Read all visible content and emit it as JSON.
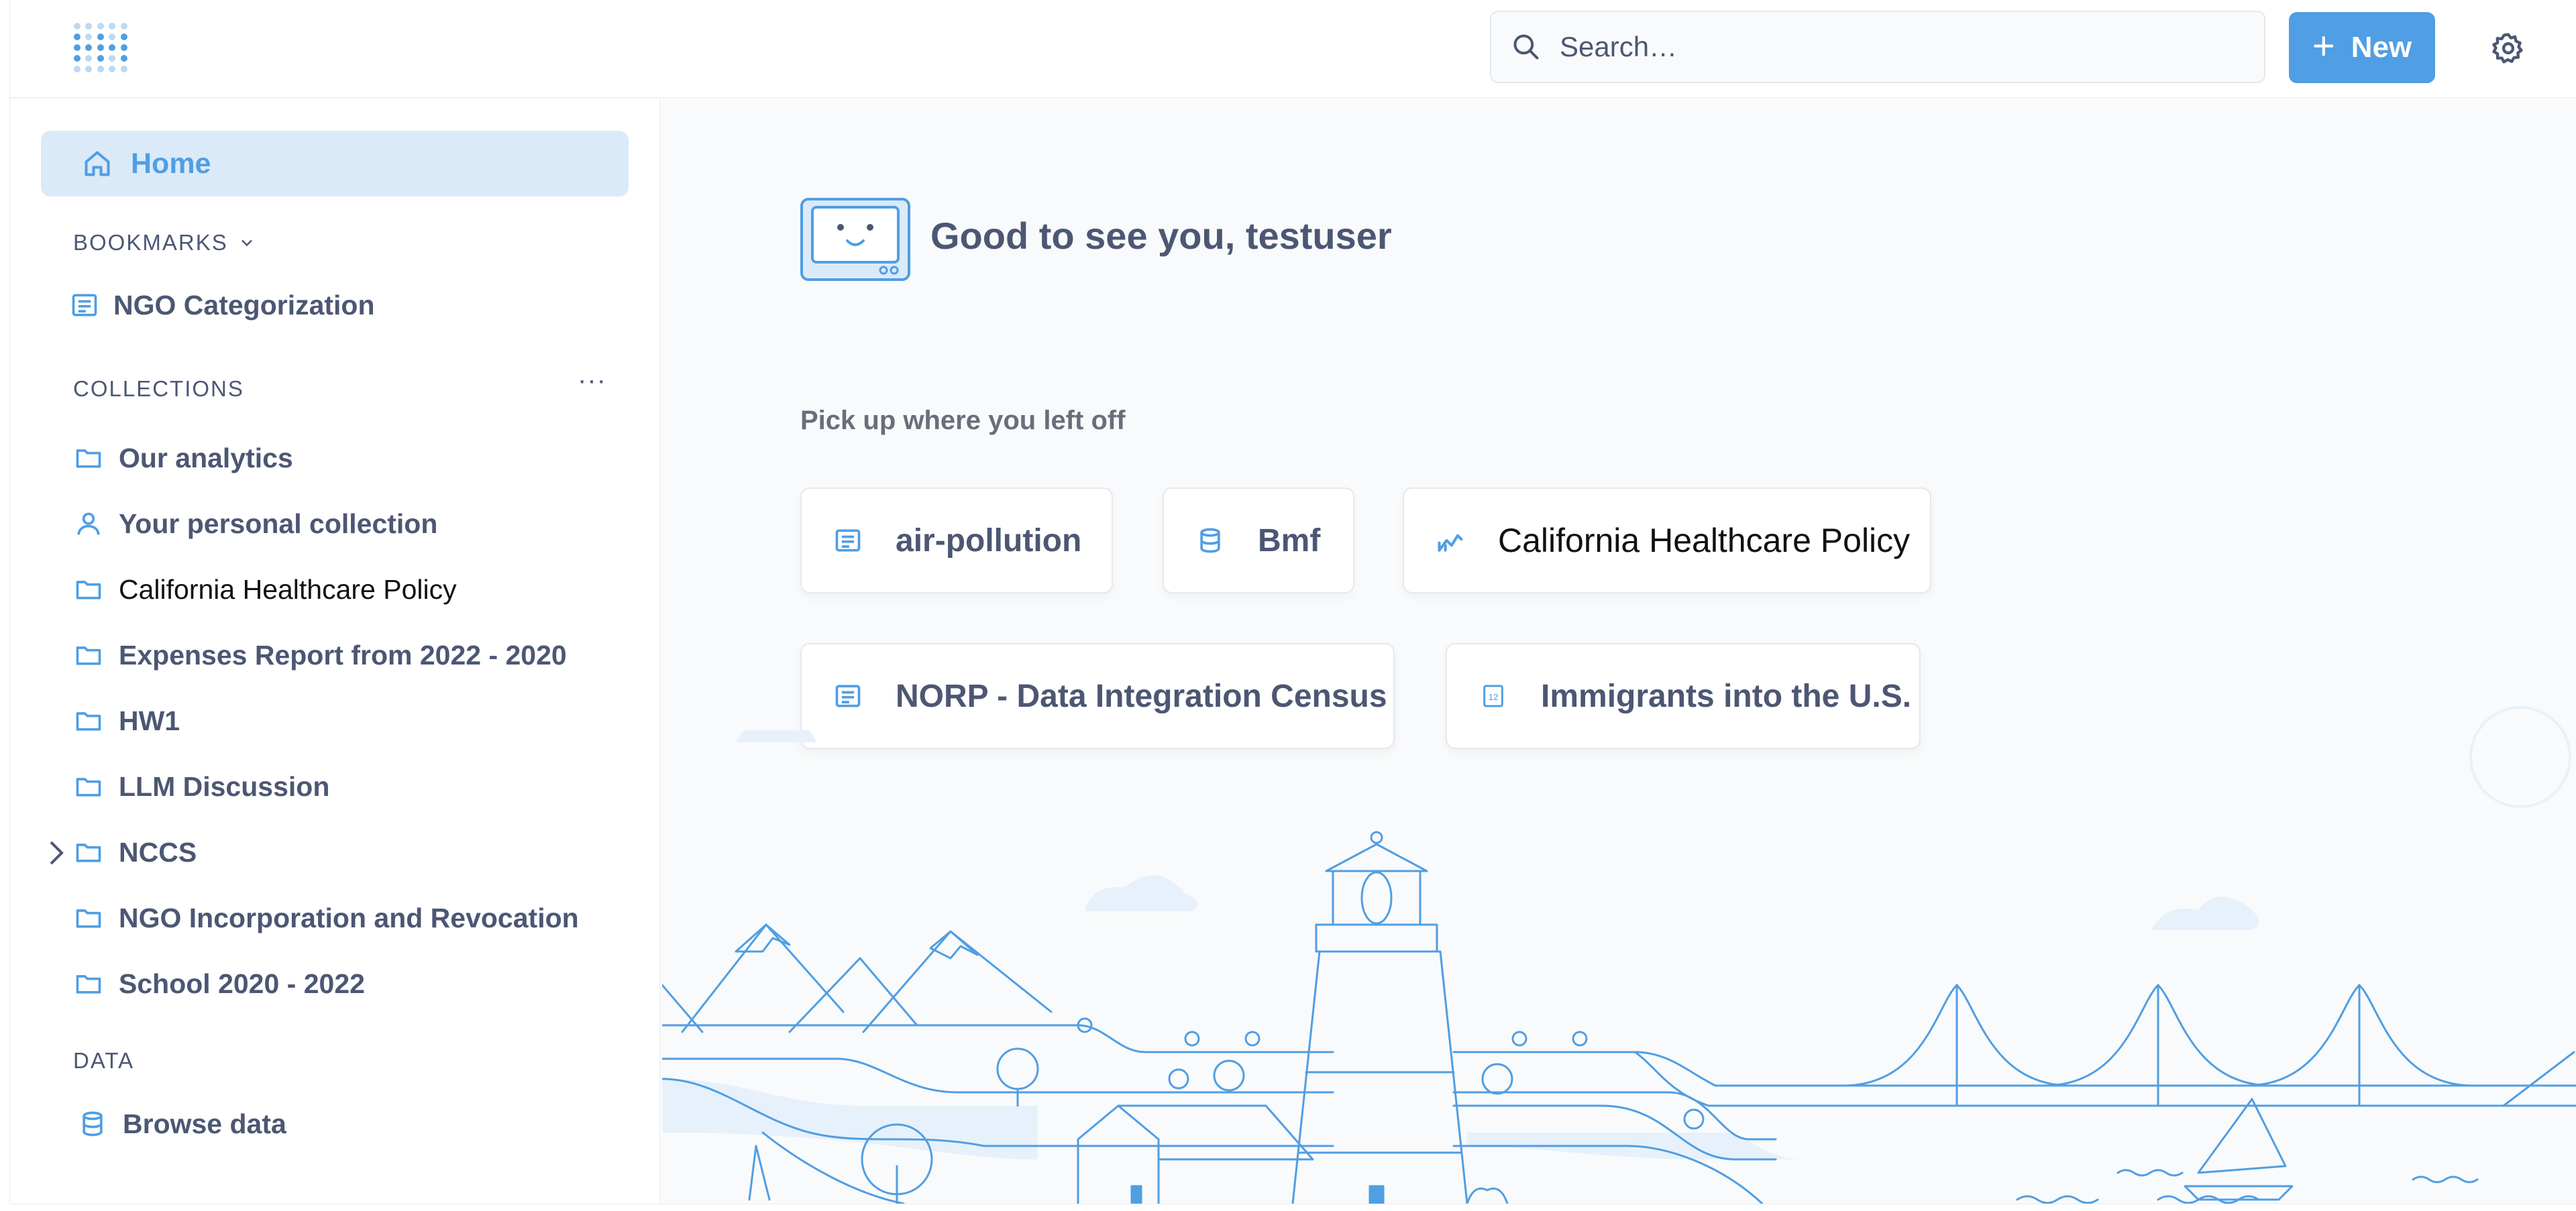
{
  "header": {
    "search_placeholder": "Search…",
    "new_label": "New"
  },
  "sidebar": {
    "home_label": "Home",
    "bookmarks_title": "BOOKMARKS",
    "bookmarks": [
      {
        "label": "NGO Categorization",
        "icon": "table-icon"
      }
    ],
    "collections_title": "COLLECTIONS",
    "collections": [
      {
        "label": "Our analytics",
        "icon": "folder-icon"
      },
      {
        "label": "Your personal collection",
        "icon": "person-icon"
      },
      {
        "label": "California Healthcare Policy",
        "icon": "folder-icon"
      },
      {
        "label": "Expenses Report from 2022 - 2020",
        "icon": "folder-icon"
      },
      {
        "label": "HW1",
        "icon": "folder-icon"
      },
      {
        "label": "LLM Discussion",
        "icon": "folder-icon"
      },
      {
        "label": "NCCS",
        "icon": "folder-icon",
        "expandable": true
      },
      {
        "label": "NGO Incorporation and Revocation",
        "icon": "folder-icon"
      },
      {
        "label": "School 2020 - 2022",
        "icon": "folder-icon"
      }
    ],
    "data_title": "DATA",
    "browse_data_label": "Browse data"
  },
  "main": {
    "greeting": "Good to see you, testuser",
    "pickup_title": "Pick up where you left off",
    "recents": [
      {
        "label": "air-pollution",
        "icon": "table-icon"
      },
      {
        "label": "Bmf",
        "icon": "database-icon"
      },
      {
        "label": "California Healthcare Policy",
        "icon": "line-chart-icon"
      },
      {
        "label": "NORP - Data Integration Census",
        "icon": "table-icon"
      },
      {
        "label": "Immigrants into the U.S.",
        "icon": "number-icon"
      }
    ]
  },
  "colors": {
    "brand": "#509ee3",
    "home_bg": "#dbeaf8",
    "text": "#4c5773",
    "main_bg": "#f9fafb"
  }
}
